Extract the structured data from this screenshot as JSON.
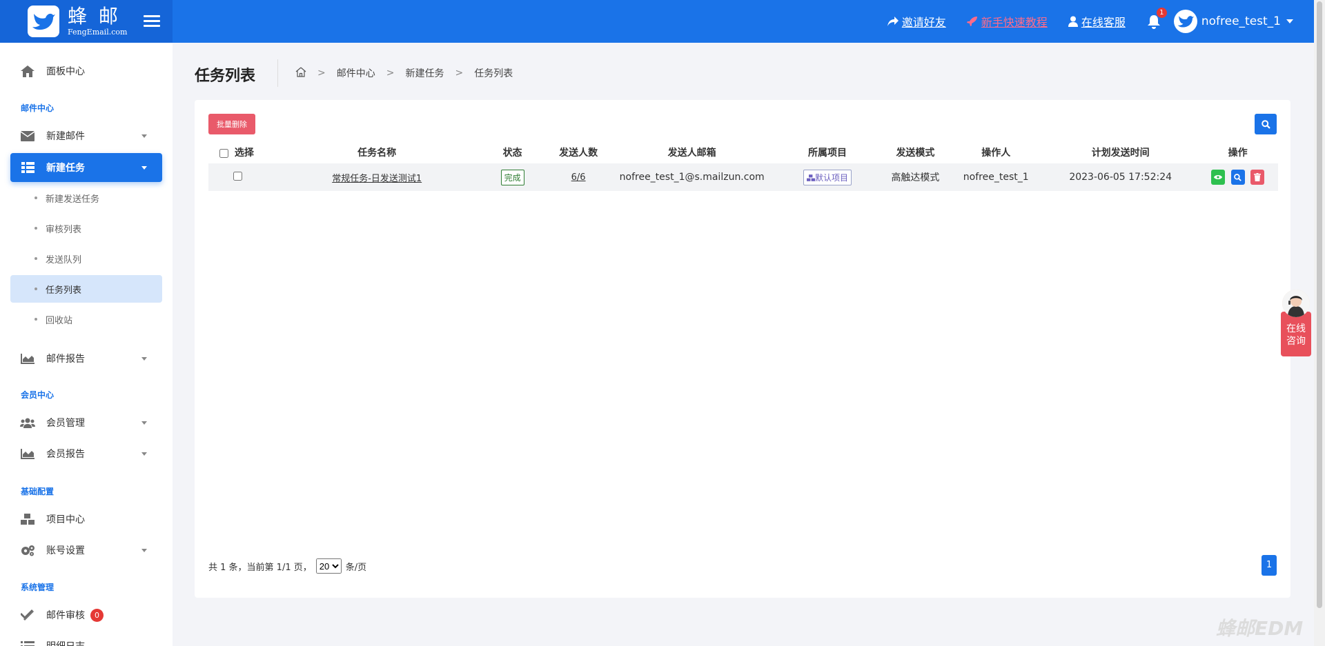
{
  "header": {
    "logo_cn": "蜂 邮",
    "logo_en": "FengEmail.com",
    "links": {
      "invite": "邀请好友",
      "tutorial": "新手快速教程",
      "support": "在线客服"
    },
    "notif_count": "1",
    "username": "nofree_test_1"
  },
  "sidebar": {
    "dashboard": "面板中心",
    "sec_mail": "邮件中心",
    "new_mail": "新建邮件",
    "new_task": "新建任务",
    "sub": {
      "new_send_task": "新建发送任务",
      "review_list": "审核列表",
      "send_queue": "发送队列",
      "task_list": "任务列表",
      "recycle": "回收站"
    },
    "mail_report": "邮件报告",
    "sec_member": "会员中心",
    "member_manage": "会员管理",
    "member_report": "会员报告",
    "sec_base": "基础配置",
    "project_center": "项目中心",
    "account_settings": "账号设置",
    "sec_system": "系统管理",
    "mail_review": "邮件审核",
    "mail_review_count": "0",
    "detail_log": "明细日志"
  },
  "main": {
    "page_title": "任务列表",
    "breadcrumb": [
      "邮件中心",
      "新建任务",
      "任务列表"
    ],
    "batch_delete": "批量删除",
    "columns": [
      "选择",
      "任务名称",
      "状态",
      "发送人数",
      "发送人邮箱",
      "所属项目",
      "发送模式",
      "操作人",
      "计划发送时间",
      "操作"
    ],
    "rows": [
      {
        "name": "常规任务-日发送测试1",
        "status": "完成",
        "count": "6/6",
        "sender": "nofree_test_1@s.mailzun.com",
        "project": "默认项目",
        "mode": "高触达模式",
        "operator": "nofree_test_1",
        "time": "2023-06-05 17:52:24"
      }
    ],
    "pager": {
      "info": "共 1 条，当前第 1/1 页，",
      "page_size": "20",
      "per_page_suffix": "条/页",
      "current_page": "1"
    }
  },
  "float": {
    "consult_line1": "在线",
    "consult_line2": "咨询"
  },
  "watermark": "蜂邮EDM"
}
